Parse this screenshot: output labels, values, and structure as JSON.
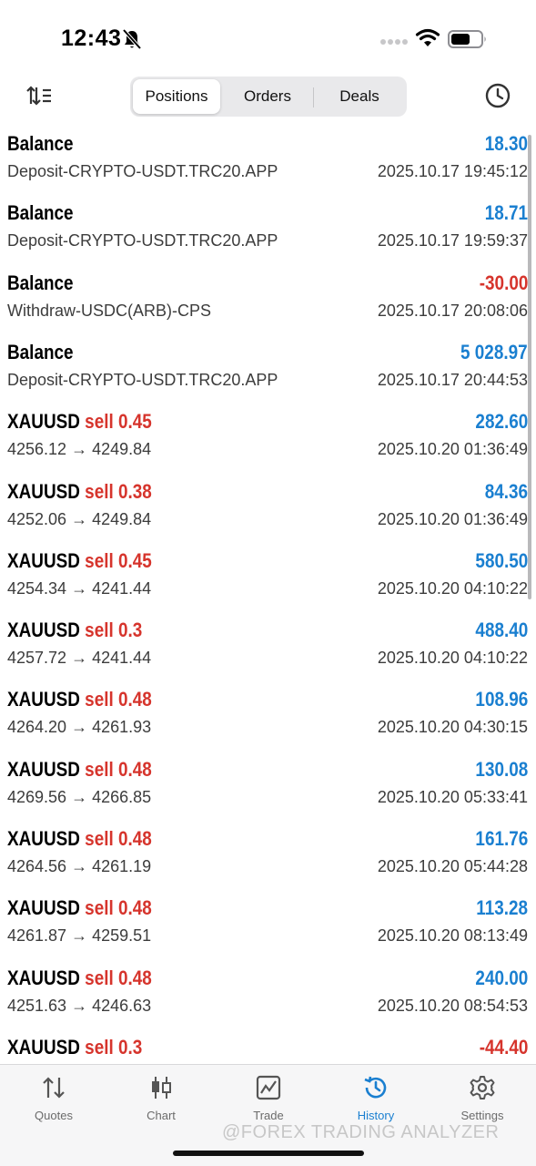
{
  "status": {
    "time": "12:43"
  },
  "segments": {
    "positions": "Positions",
    "orders": "Orders",
    "deals": "Deals",
    "active": "Positions"
  },
  "rows": [
    {
      "name": "Balance",
      "side": "",
      "subtitle": "Deposit-CRYPTO-USDT.TRC20.APP",
      "amount": "18.30",
      "sign": "pos",
      "time": "2025.10.17 19:45:12"
    },
    {
      "name": "Balance",
      "side": "",
      "subtitle": "Deposit-CRYPTO-USDT.TRC20.APP",
      "amount": "18.71",
      "sign": "pos",
      "time": "2025.10.17 19:59:37"
    },
    {
      "name": "Balance",
      "side": "",
      "subtitle": "Withdraw-USDC(ARB)-CPS",
      "amount": "-30.00",
      "sign": "neg",
      "time": "2025.10.17 20:08:06"
    },
    {
      "name": "Balance",
      "side": "",
      "subtitle": "Deposit-CRYPTO-USDT.TRC20.APP",
      "amount": "5 028.97",
      "sign": "pos",
      "time": "2025.10.17 20:44:53"
    },
    {
      "name": "XAUUSD",
      "side": "sell 0.45",
      "subtitle": "4256.12 → 4249.84",
      "amount": "282.60",
      "sign": "pos",
      "time": "2025.10.20 01:36:49"
    },
    {
      "name": "XAUUSD",
      "side": "sell 0.38",
      "subtitle": "4252.06 → 4249.84",
      "amount": "84.36",
      "sign": "pos",
      "time": "2025.10.20 01:36:49"
    },
    {
      "name": "XAUUSD",
      "side": "sell 0.45",
      "subtitle": "4254.34 → 4241.44",
      "amount": "580.50",
      "sign": "pos",
      "time": "2025.10.20 04:10:22"
    },
    {
      "name": "XAUUSD",
      "side": "sell 0.3",
      "subtitle": "4257.72 → 4241.44",
      "amount": "488.40",
      "sign": "pos",
      "time": "2025.10.20 04:10:22"
    },
    {
      "name": "XAUUSD",
      "side": "sell 0.48",
      "subtitle": "4264.20 → 4261.93",
      "amount": "108.96",
      "sign": "pos",
      "time": "2025.10.20 04:30:15"
    },
    {
      "name": "XAUUSD",
      "side": "sell 0.48",
      "subtitle": "4269.56 → 4266.85",
      "amount": "130.08",
      "sign": "pos",
      "time": "2025.10.20 05:33:41"
    },
    {
      "name": "XAUUSD",
      "side": "sell 0.48",
      "subtitle": "4264.56 → 4261.19",
      "amount": "161.76",
      "sign": "pos",
      "time": "2025.10.20 05:44:28"
    },
    {
      "name": "XAUUSD",
      "side": "sell 0.48",
      "subtitle": "4261.87 → 4259.51",
      "amount": "113.28",
      "sign": "pos",
      "time": "2025.10.20 08:13:49"
    },
    {
      "name": "XAUUSD",
      "side": "sell 0.48",
      "subtitle": "4251.63 → 4246.63",
      "amount": "240.00",
      "sign": "pos",
      "time": "2025.10.20 08:54:53"
    },
    {
      "name": "XAUUSD",
      "side": "sell 0.3",
      "subtitle": "",
      "amount": "-44.40",
      "sign": "neg",
      "time": ""
    }
  ],
  "tabs": [
    {
      "label": "Quotes",
      "icon": "quotes-icon"
    },
    {
      "label": "Chart",
      "icon": "chart-icon"
    },
    {
      "label": "Trade",
      "icon": "trade-icon"
    },
    {
      "label": "History",
      "icon": "history-icon",
      "active": true
    },
    {
      "label": "Settings",
      "icon": "settings-icon"
    }
  ],
  "watermark": "@FOREX TRADING ANALYZER",
  "colors": {
    "accent": "#1a7fd0",
    "negative": "#d6342c"
  }
}
